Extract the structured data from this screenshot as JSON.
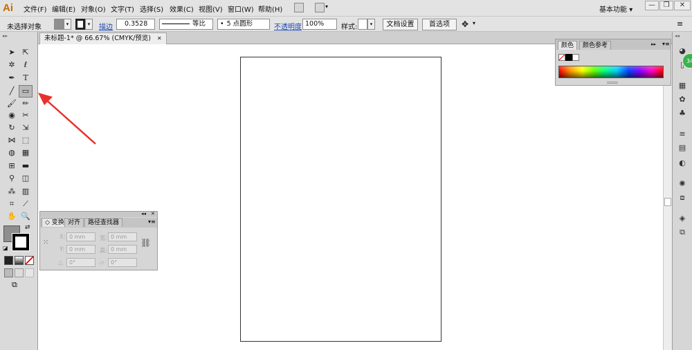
{
  "app": {
    "logo": "Ai"
  },
  "menubar": {
    "items": [
      "文件(F)",
      "编辑(E)",
      "对象(O)",
      "文字(T)",
      "选择(S)",
      "效果(C)",
      "视图(V)",
      "窗口(W)",
      "帮助(H)"
    ],
    "workspace": "基本功能",
    "workspace_arrow": "▾",
    "window_buttons": {
      "minimize": "—",
      "restore": "❐",
      "close": "✕"
    }
  },
  "control_bar": {
    "selection_status": "未选择对象",
    "stroke_label": "描边",
    "stroke_weight": "0.3528",
    "profile": "等比",
    "brush": "5 点圆形",
    "opacity_label": "不透明度",
    "opacity_value": "100%",
    "style_label": "样式:",
    "doc_setup_button": "文档设置",
    "preferences_button": "首选项"
  },
  "document": {
    "tab_label": "未标题-1* @ 66.67% (CMYK/预览)",
    "close": "✕"
  },
  "color_panel": {
    "tabs": [
      "颜色",
      "颜色参考"
    ],
    "collapse": "▸▸",
    "menu": "▾≡"
  },
  "transform_panel": {
    "tabs": [
      "变换",
      "对齐",
      "路径查找器"
    ],
    "collapse": "◂◂",
    "close": "✕",
    "fields": {
      "x_label": "X:",
      "x_value": "0 mm",
      "w_label": "宽:",
      "w_value": "0 mm",
      "y_label": "Y:",
      "y_value": "0 mm",
      "h_label": "高:",
      "h_value": "0 mm",
      "rotate_value": "0°",
      "shear_value": "0°"
    }
  },
  "badge": {
    "text": "34"
  },
  "colors": {
    "ui_bg": "#e3e3e3",
    "panel_bg": "#d6d6d6",
    "link": "#1b49b3",
    "annotation_arrow": "#e8312b",
    "badge": "#38b24a"
  }
}
